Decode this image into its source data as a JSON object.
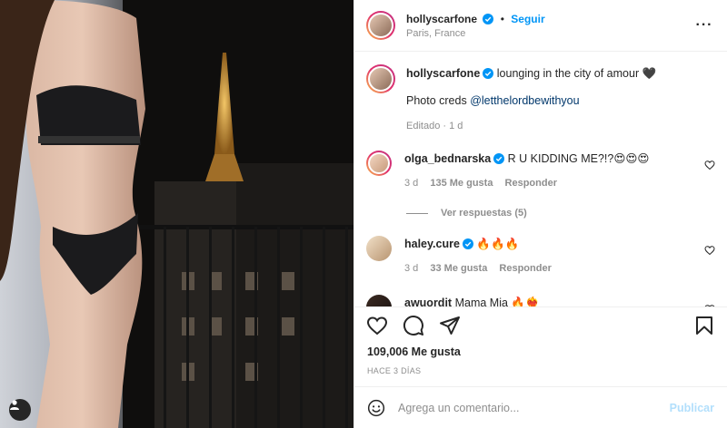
{
  "post": {
    "author": "hollyscarfone",
    "follow_label": "Seguir",
    "location": "Paris, France",
    "caption": "lounging in the city of amour 🖤",
    "caption_line2_prefix": "Photo creds ",
    "caption_mention": "@letthelordbewithyou",
    "caption_meta": "Editado · 1 d",
    "likes": "109,006 Me gusta",
    "posted_ago": "HACE 3 DÍAS"
  },
  "comments": [
    {
      "user": "olga_bednarska",
      "text": "R U KIDDING ME?!?😍😍😍",
      "age": "3 d",
      "likes": "135 Me gusta",
      "reply": "Responder",
      "view_replies": "Ver respuestas (5)"
    },
    {
      "user": "haley.cure",
      "text": "🔥🔥🔥",
      "age": "3 d",
      "likes": "33 Me gusta",
      "reply": "Responder"
    },
    {
      "user": "awuordit",
      "text": "Mama Mia 🔥❤️‍🔥"
    }
  ],
  "add_comment": {
    "placeholder": "Agrega un comentario...",
    "publish_label": "Publicar"
  },
  "colors": {
    "accent": "#0095f6",
    "publish_disabled": "#b2dffc",
    "muted": "#8e8e8e",
    "text": "#262626"
  },
  "icons": [
    "verified-icon",
    "more-options-icon",
    "heart-icon",
    "comment-icon",
    "share-icon",
    "bookmark-icon",
    "emoji-icon",
    "user-tag-icon"
  ]
}
